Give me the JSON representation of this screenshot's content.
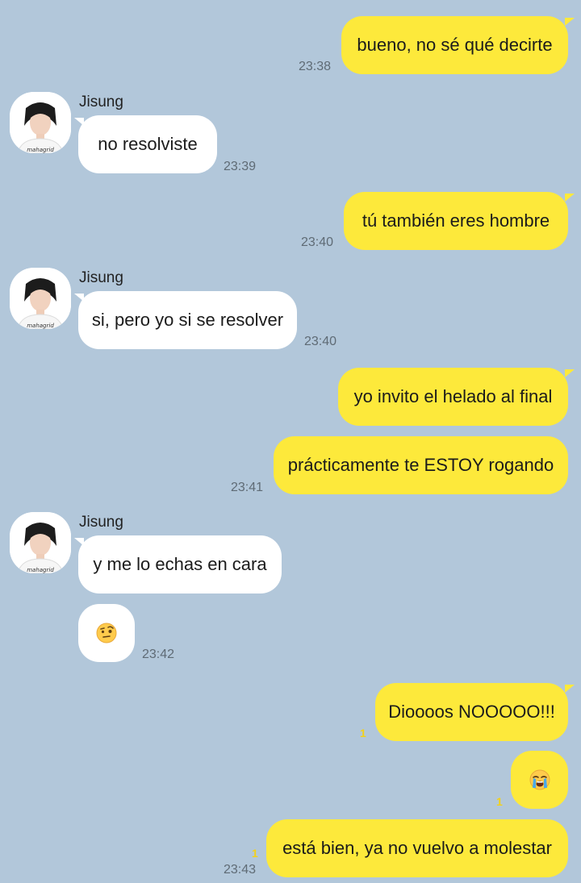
{
  "messages": [
    {
      "from": "me",
      "text": "bueno, no sé qué decirte",
      "time": "23:38"
    },
    {
      "from": "them",
      "sender": "Jisung",
      "text": "no resolviste",
      "time": "23:39"
    },
    {
      "from": "me",
      "text": "tú también eres hombre",
      "time": "23:40"
    },
    {
      "from": "them",
      "sender": "Jisung",
      "text": "si, pero yo si se resolver",
      "time": "23:40"
    },
    {
      "from": "me",
      "text": "yo invito el helado al final"
    },
    {
      "from": "me",
      "text": "prácticamente te ESTOY rogando",
      "time": "23:41"
    },
    {
      "from": "them",
      "sender": "Jisung",
      "text": "y me lo echas en cara"
    },
    {
      "from": "them",
      "emoji": "face-with-raised-eyebrow",
      "time": "23:42"
    },
    {
      "from": "me",
      "text": "Dioooos NOOOOO!!!",
      "unread": "1"
    },
    {
      "from": "me",
      "emoji": "loudly-crying-face",
      "unread": "1"
    },
    {
      "from": "me",
      "text": "está bien, ya no vuelvo a molestar",
      "unread": "1",
      "time": "23:43"
    }
  ],
  "avatar": {
    "caption": "mahagrid"
  },
  "colors": {
    "background": "#b2c7da",
    "my_bubble": "#fde93b",
    "their_bubble": "#ffffff",
    "unread": "#f3d11a"
  }
}
